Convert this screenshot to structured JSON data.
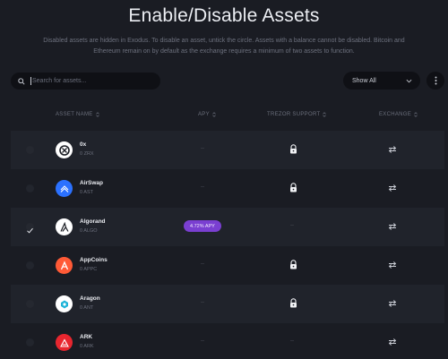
{
  "page": {
    "title": "Enable/Disable Assets",
    "description": "Disabled assets are hidden in Exodus. To disable an asset, untick the circle. Assets with a balance cannot be disabled. Bitcoin and Ethereum remain on by default as the exchange requires a minimum of two assets to function."
  },
  "search": {
    "placeholder": "Search for assets..."
  },
  "filter": {
    "selected": "Show All"
  },
  "columns": {
    "asset_name": "ASSET NAME",
    "apy": "APY",
    "trezor_support": "TREZOR SUPPORT",
    "exchange": "EXCHANGE"
  },
  "assets": [
    {
      "name": "0x",
      "balance": "0 ZRX",
      "enabled": false,
      "apy": "--",
      "trezor": "lock",
      "logo_color": "#ffffff",
      "logo_fg": "#1a1c23",
      "icon": "0x-logo-icon"
    },
    {
      "name": "AirSwap",
      "balance": "0 AST",
      "enabled": false,
      "apy": "--",
      "trezor": "lock",
      "logo_color": "#2b71ff",
      "logo_fg": "#ffffff",
      "icon": "airswap-logo-icon"
    },
    {
      "name": "Algorand",
      "balance": "0 ALGO",
      "enabled": true,
      "apy": "4.72% APY",
      "trezor": "--",
      "logo_color": "#ffffff",
      "logo_fg": "#1a1c23",
      "icon": "algorand-logo-icon"
    },
    {
      "name": "AppCoins",
      "balance": "0 APPC",
      "enabled": false,
      "apy": "--",
      "trezor": "lock",
      "logo_color": "#ff5a36",
      "logo_fg": "#ffffff",
      "icon": "appcoins-logo-icon"
    },
    {
      "name": "Aragon",
      "balance": "0 ANT",
      "enabled": false,
      "apy": "--",
      "trezor": "lock",
      "logo_color": "#ffffff",
      "logo_fg": "#1fb4d8",
      "icon": "aragon-logo-icon"
    },
    {
      "name": "ARK",
      "balance": "0 ARK",
      "enabled": false,
      "apy": "--",
      "trezor": "--",
      "logo_color": "#e8262f",
      "logo_fg": "#ffffff",
      "icon": "ark-logo-icon"
    }
  ],
  "colors": {
    "background": "#1a1c23",
    "row_alt": "#20232b",
    "apy_badge": "#7a3fd1"
  }
}
